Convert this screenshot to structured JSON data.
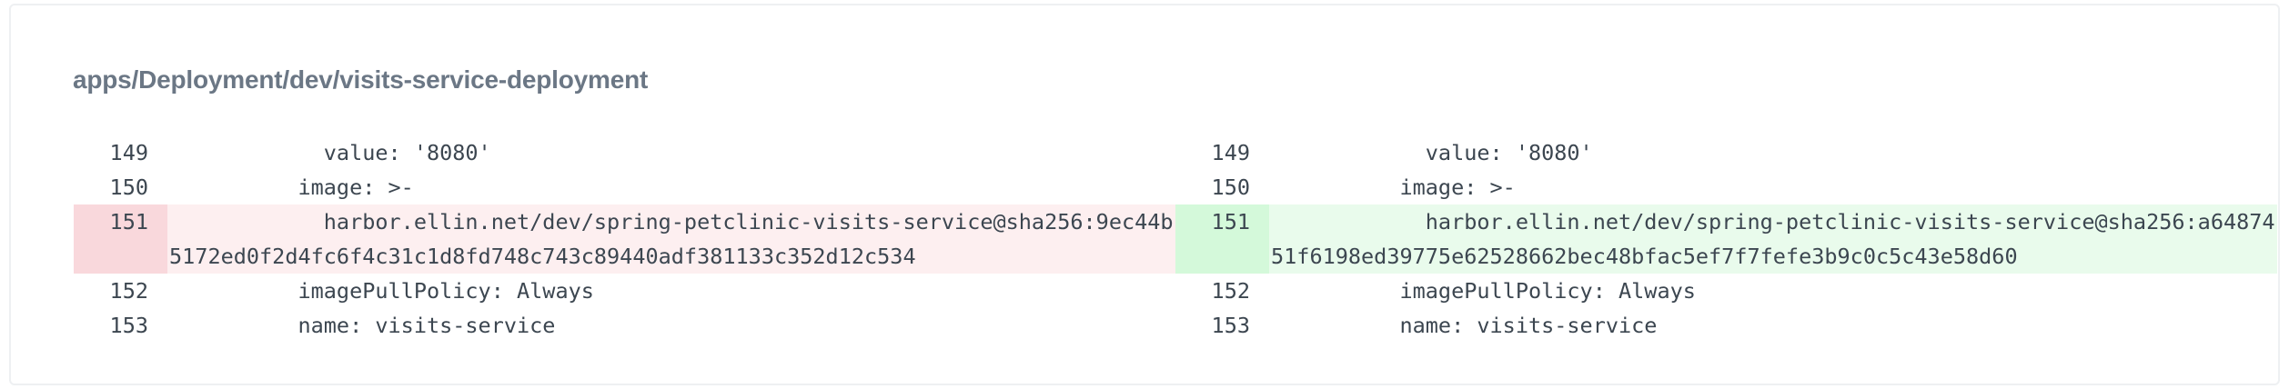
{
  "title": "apps/Deployment/dev/visits-service-deployment",
  "left": {
    "lines": [
      {
        "num": "149",
        "text": "            value: '8080'",
        "type": "context"
      },
      {
        "num": "150",
        "text": "          image: >-",
        "type": "context"
      },
      {
        "num": "151",
        "text": "            harbor.ellin.net/dev/spring-petclinic-visits-service@sha256:9ec44b5172ed0f2d4fc6f4c31c1d8fd748c743c89440adf381133c352d12c534",
        "type": "removed"
      },
      {
        "num": "152",
        "text": "          imagePullPolicy: Always",
        "type": "context"
      },
      {
        "num": "153",
        "text": "          name: visits-service",
        "type": "context"
      }
    ]
  },
  "right": {
    "lines": [
      {
        "num": "149",
        "text": "            value: '8080'",
        "type": "context"
      },
      {
        "num": "150",
        "text": "          image: >-",
        "type": "context"
      },
      {
        "num": "151",
        "text": "            harbor.ellin.net/dev/spring-petclinic-visits-service@sha256:a6487451f6198ed39775e62528662bec48bfac5ef7f7fefe3b9c0c5c43e58d60",
        "type": "added"
      },
      {
        "num": "152",
        "text": "          imagePullPolicy: Always",
        "type": "context"
      },
      {
        "num": "153",
        "text": "          name: visits-service",
        "type": "context"
      }
    ]
  },
  "colors": {
    "removed_gutter": "#f9d8dc",
    "removed_line": "#fdeff0",
    "added_gutter": "#d4f9da",
    "added_line": "#e9fbec"
  }
}
